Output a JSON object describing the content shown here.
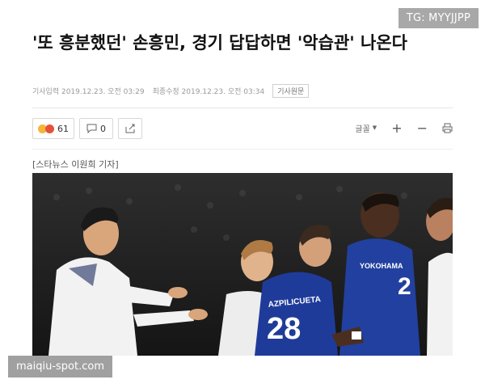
{
  "watermark_top": "TG: MYYJJPP",
  "watermark_bottom": "maiqiu-spot.com",
  "article": {
    "headline": "'또 흥분했던' 손흥민, 경기 답답하면 '악습관' 나온다",
    "published": "기사입력 2019.12.23. 오전 03:29",
    "updated": "최종수정 2019.12.23. 오전 03:34",
    "original_label": "기사원문",
    "reporter": "[스타뉴스 이원희 기자]"
  },
  "actions": {
    "reaction_count": "61",
    "comment_count": "0",
    "font_label": "글꼴"
  },
  "photo": {
    "left_player_kit": "white",
    "shirt_text": "YOKOHAMA",
    "shirt_number_front": "28",
    "shirt_number_right": "2",
    "colors": {
      "blue_kit": "#1f3b9a",
      "white_kit": "#f2f2f2",
      "crowd": "#2b2b2b"
    }
  }
}
